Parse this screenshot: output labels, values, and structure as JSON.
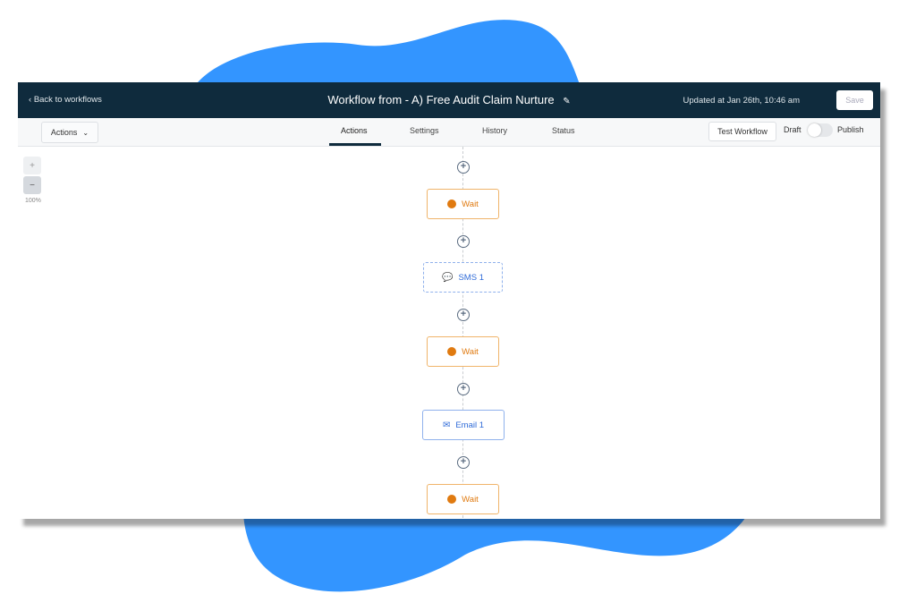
{
  "header": {
    "back_label": "Back to workflows",
    "title": "Workflow from - A) Free Audit Claim Nurture",
    "updated": "Updated at Jan 26th, 10:46 am",
    "save_label": "Save"
  },
  "toolbar": {
    "actions_dropdown": "Actions",
    "tabs": [
      {
        "label": "Actions",
        "active": true
      },
      {
        "label": "Settings"
      },
      {
        "label": "History"
      },
      {
        "label": "Status"
      }
    ],
    "test_label": "Test Workflow",
    "draft_label": "Draft",
    "publish_label": "Publish",
    "published": false
  },
  "zoom": {
    "plus": "+",
    "minus": "−",
    "level": "100%"
  },
  "nodes": [
    {
      "label": "Wait",
      "icon": "clock-icon"
    },
    {
      "label": "SMS 1",
      "icon": "sms-icon"
    },
    {
      "label": "Wait",
      "icon": "clock-icon"
    },
    {
      "label": "Email 1",
      "icon": "email-icon"
    },
    {
      "label": "Wait",
      "icon": "clock-icon"
    }
  ],
  "colors": {
    "header": "#0f2b3d",
    "wait": "#e07a10",
    "action": "#2f6bd8",
    "blob": "#3395ff"
  }
}
